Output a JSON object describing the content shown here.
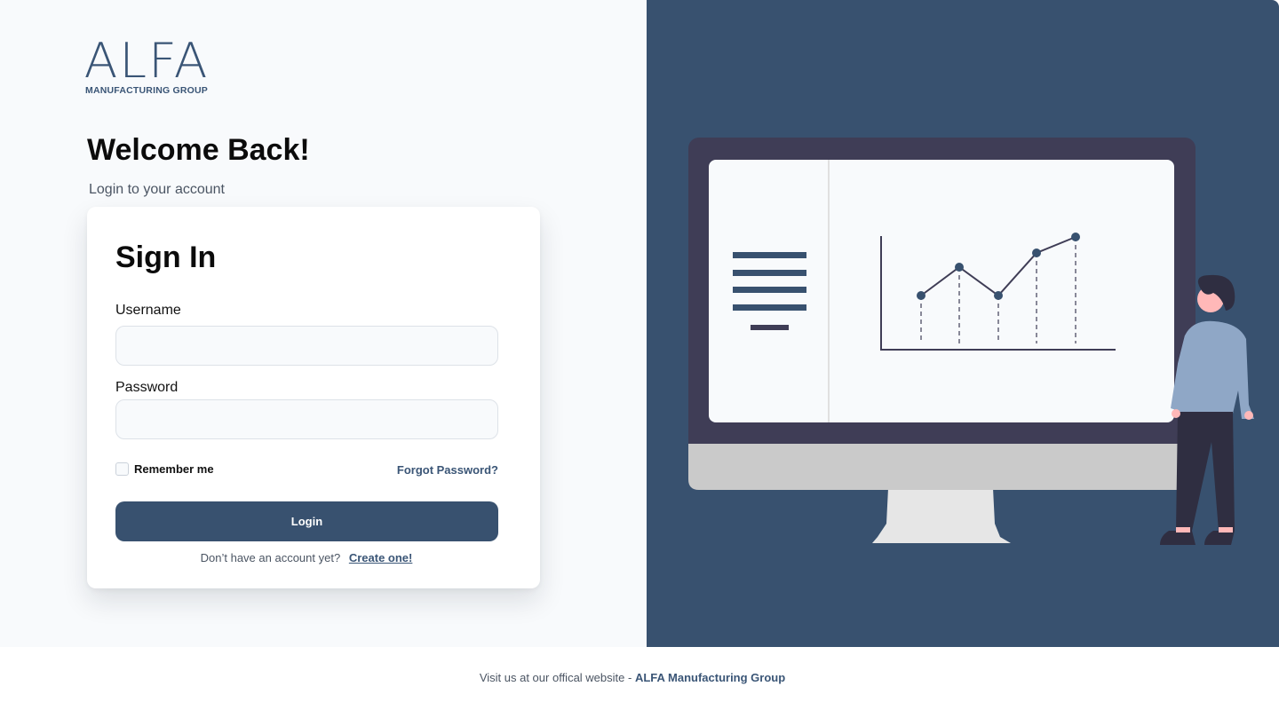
{
  "brand": {
    "logo_word": "ALFA",
    "logo_sub": "MANUFACTURING GROUP"
  },
  "hero": {
    "title": "Welcome Back!",
    "subtitle": "Login to your account"
  },
  "signin": {
    "title": "Sign In",
    "username_label": "Username",
    "username_value": "",
    "password_label": "Password",
    "password_value": "",
    "remember_label": "Remember me",
    "remember_checked": false,
    "forgot_label": "Forgot Password?",
    "login_label": "Login",
    "signup_prompt": "Don’t have an account yet?",
    "signup_link": "Create one!"
  },
  "footer": {
    "text": "Visit us at our offical website - ",
    "link": "ALFA Manufacturing Group"
  },
  "colors": {
    "brand_primary": "#38516f",
    "left_background": "#f8fafc",
    "monitor_frame": "#3f3d56",
    "chart_point": "#38516f"
  },
  "illustration": {
    "icons": [
      "monitor-icon",
      "line-chart-icon",
      "person-icon"
    ]
  }
}
